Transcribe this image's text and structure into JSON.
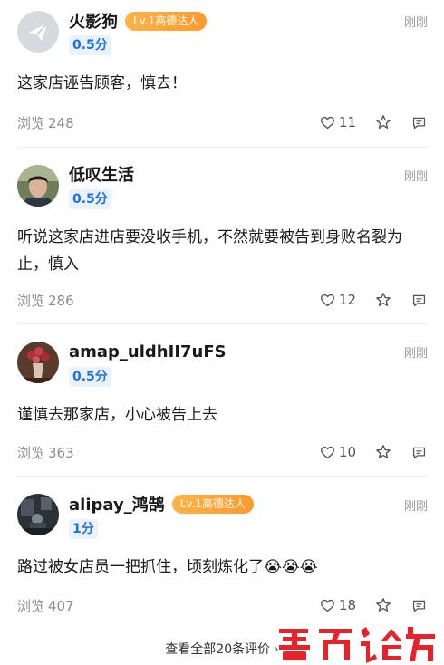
{
  "reviews": [
    {
      "username": "火影狗",
      "level_badge": "Lv.1高德达人",
      "score": "0.5分",
      "time": "刚刚",
      "content": "这家店诬告顾客，慎去！",
      "views_label": "浏览",
      "views": "248",
      "likes": "11",
      "avatar": "paper-plane-icon"
    },
    {
      "username": "低叹生活",
      "level_badge": "",
      "score": "0.5分",
      "time": "刚刚",
      "content": "听说这家店进店要没收手机，不然就要被告到身败名裂为止，慎入",
      "views_label": "浏览",
      "views": "286",
      "likes": "12",
      "avatar": "person-photo"
    },
    {
      "username": "amap_uldhII7uFS",
      "level_badge": "",
      "score": "0.5分",
      "time": "刚刚",
      "content": "谨慎去那家店，小心被告上去",
      "views_label": "浏览",
      "views": "363",
      "likes": "10",
      "avatar": "flower-photo"
    },
    {
      "username": "alipay_鸿鹄",
      "level_badge": "Lv.1高德达人",
      "score": "1分",
      "time": "刚刚",
      "content": "路过被女店员一把抓住，顷刻炼化了😭😭😭",
      "views_label": "浏览",
      "views": "407",
      "likes": "18",
      "avatar": "dark-scene-photo"
    }
  ],
  "view_all_label": "查看全部20条评价",
  "watermark_text": "青远论坛",
  "colors": {
    "score_blue": "#1f6fe5",
    "score_bg": "#e9f2ff",
    "badge_orange": "#ff9a2e",
    "watermark_red": "#e8222a"
  }
}
